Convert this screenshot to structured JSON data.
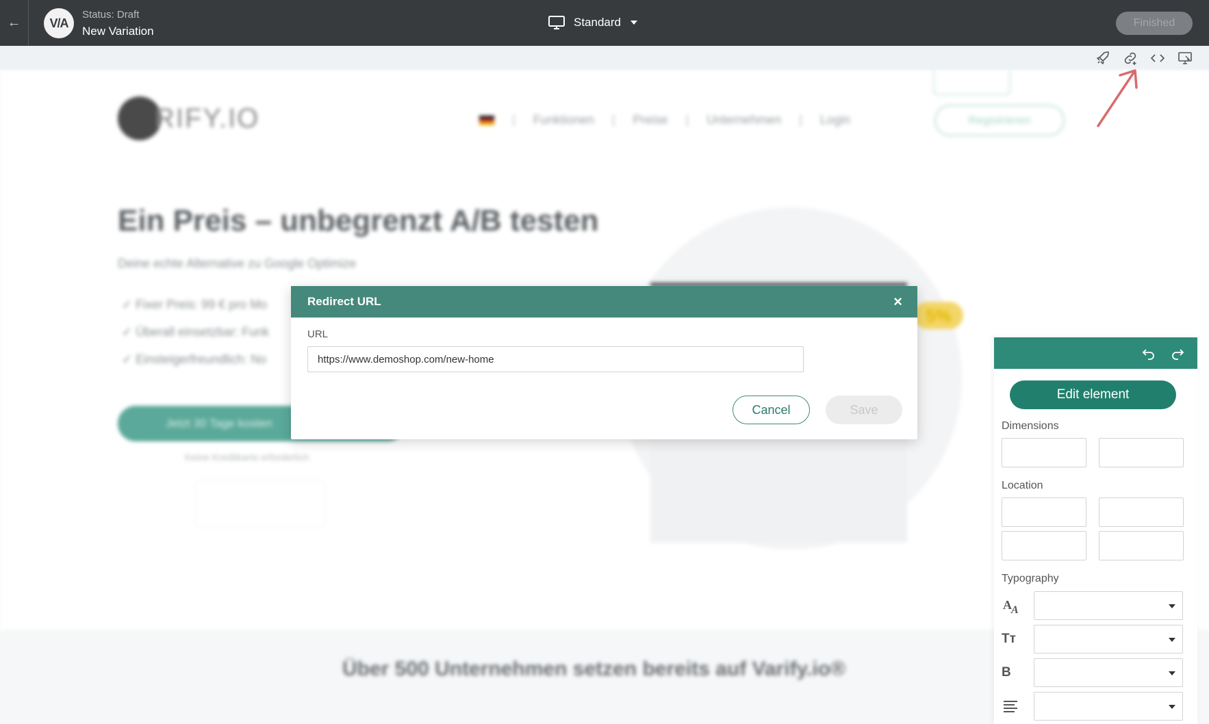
{
  "topbar": {
    "back_icon": "arrow-left-icon",
    "logo_text": "V/A",
    "status": "Status: Draft",
    "variation_name": "New Variation",
    "device_mode": "Standard",
    "finished_label": "Finished"
  },
  "toolbar": {
    "icons": [
      "rocket-icon",
      "redirect-link-icon",
      "code-icon",
      "preview-icon"
    ]
  },
  "background_site": {
    "logo_text": "RIFY.IO",
    "nav": [
      "Funktionen",
      "Preise",
      "Unternehmen",
      "Login"
    ],
    "register_label": "Registrieren",
    "hero_title": "Ein Preis – unbegrenzt A/B testen",
    "hero_subtitle": "Deine echte Alternative zu Google Optimize",
    "checks": [
      "Fixer Preis: 99 € pro Mo",
      "Überall einsetzbar: Funk",
      "Einsteigerfreundlich: No"
    ],
    "cta": "Jetzt 30 Tage kosten",
    "cta_note": "Keine Kreditkarte erforderlich",
    "tag": "5%",
    "bottom_heading": "Über 500 Unternehmen setzen bereits auf Varify.io®"
  },
  "dialog": {
    "title": "Redirect URL",
    "close_symbol": "×",
    "url_label": "URL",
    "url_value": "https://www.demoshop.com/new-home",
    "cancel_label": "Cancel",
    "save_label": "Save"
  },
  "edit_panel": {
    "edit_element_label": "Edit element",
    "dimensions_label": "Dimensions",
    "location_label": "Location",
    "typography_label": "Typography",
    "typo_icons": [
      "font-family-icon",
      "font-size-icon",
      "font-weight-icon",
      "text-align-icon"
    ],
    "font_size_glyph": "Tт",
    "font_weight_glyph": "B"
  },
  "colors": {
    "topbar": "#383b3e",
    "dialog_header": "#44897b",
    "panel_accent": "#2e8b79",
    "annotation_arrow": "#d96b6b"
  }
}
